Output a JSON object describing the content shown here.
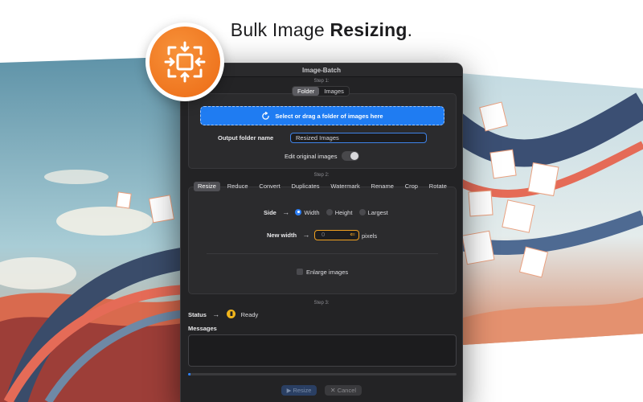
{
  "headline": {
    "prefix": "Bulk Image ",
    "bold": "Resizing",
    "suffix": "."
  },
  "app": {
    "icon": "resize-arrows-icon",
    "accent": "#ec6a14"
  },
  "window": {
    "title": "Image-Batch",
    "step1": {
      "label": "Step 1:",
      "source_tabs": [
        {
          "label": "Folder",
          "active": true
        },
        {
          "label": "Images",
          "active": false
        }
      ],
      "drop_zone": {
        "label": "Select or drag a folder of images here",
        "icon": "folder-refresh-icon",
        "color": "#1f7cf2"
      },
      "output_folder": {
        "label": "Output folder name",
        "value": "Resized Images"
      },
      "edit_original": {
        "label": "Edit original images",
        "enabled": false
      }
    },
    "step2": {
      "label": "Step 2:",
      "tabs": [
        {
          "label": "Resize",
          "active": true
        },
        {
          "label": "Reduce",
          "active": false
        },
        {
          "label": "Convert",
          "active": false
        },
        {
          "label": "Duplicates",
          "active": false
        },
        {
          "label": "Watermark",
          "active": false
        },
        {
          "label": "Rename",
          "active": false
        },
        {
          "label": "Crop",
          "active": false
        },
        {
          "label": "Rotate",
          "active": false
        }
      ],
      "side": {
        "label": "Side",
        "options": [
          {
            "label": "Width",
            "selected": true
          },
          {
            "label": "Height",
            "selected": false
          },
          {
            "label": "Largest",
            "selected": false
          }
        ]
      },
      "new_width": {
        "label": "New width",
        "value": "0",
        "unit": "pixels"
      },
      "enlarge": {
        "label": "Enlarge images",
        "checked": false
      }
    },
    "step3": {
      "label": "Step 3:",
      "status": {
        "label": "Status",
        "value": "Ready",
        "color": "#f1b51c"
      },
      "messages": {
        "label": "Messages",
        "value": ""
      },
      "progress": 0.01,
      "buttons": {
        "resize": "Resize",
        "cancel": "Cancel"
      }
    }
  }
}
